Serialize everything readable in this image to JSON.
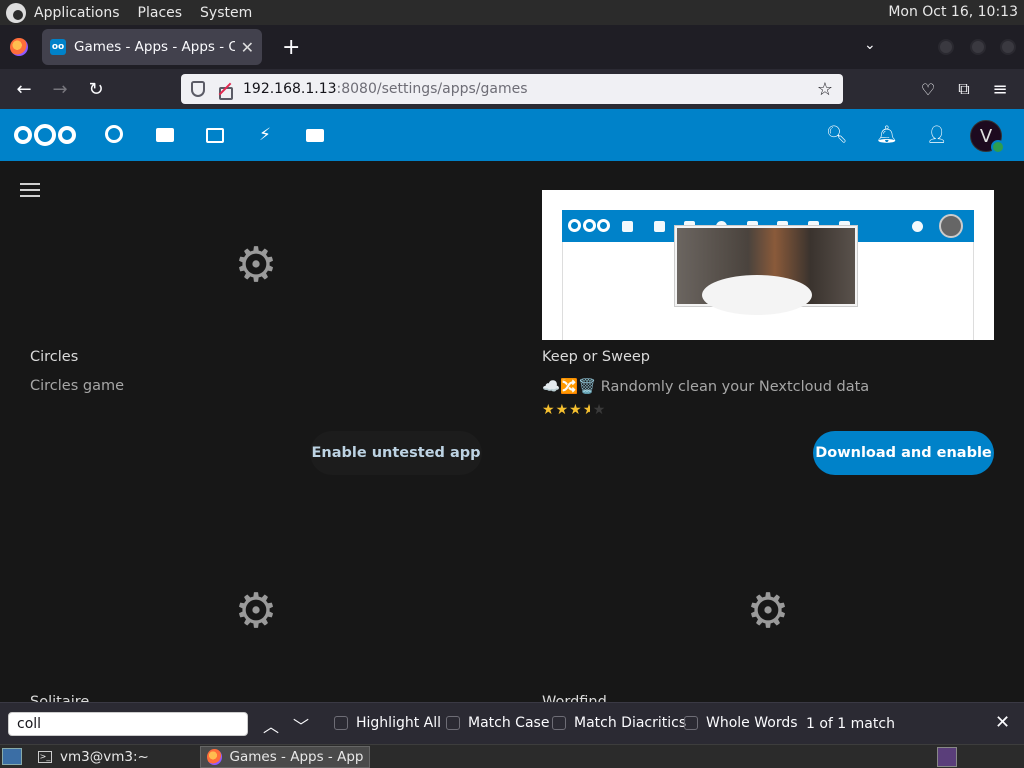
{
  "topbar": {
    "menus": [
      "Applications",
      "Places",
      "System"
    ],
    "clock": "Mon Oct 16, 10:13"
  },
  "browser": {
    "tab_title": "Games - Apps - Apps - Colla",
    "url_host": "192.168.1.13",
    "url_path": ":8080/settings/apps/games"
  },
  "nextcloud": {
    "avatar_letter": "V",
    "colors": {
      "brand": "#0082c9",
      "status_online": "#2d9d4f"
    }
  },
  "apps": [
    {
      "name": "Circles",
      "summary": "Circles game",
      "button": "Enable untested app"
    },
    {
      "name": "Keep or Sweep",
      "summary_prefix": "☁️🔀🗑️",
      "summary": "Randomly clean your Nextcloud data",
      "rating": 3.5,
      "rating_max": 5,
      "button": "Download and enable"
    },
    {
      "name": "Solitaire"
    },
    {
      "name": "Wordfind"
    }
  ],
  "findbar": {
    "query": "coll",
    "options": [
      "Highlight All",
      "Match Case",
      "Match Diacritics",
      "Whole Words"
    ],
    "status": "1 of 1 match"
  },
  "taskbar": {
    "tasks": [
      "vm3@vm3:~",
      "Games - Apps - App..."
    ]
  }
}
